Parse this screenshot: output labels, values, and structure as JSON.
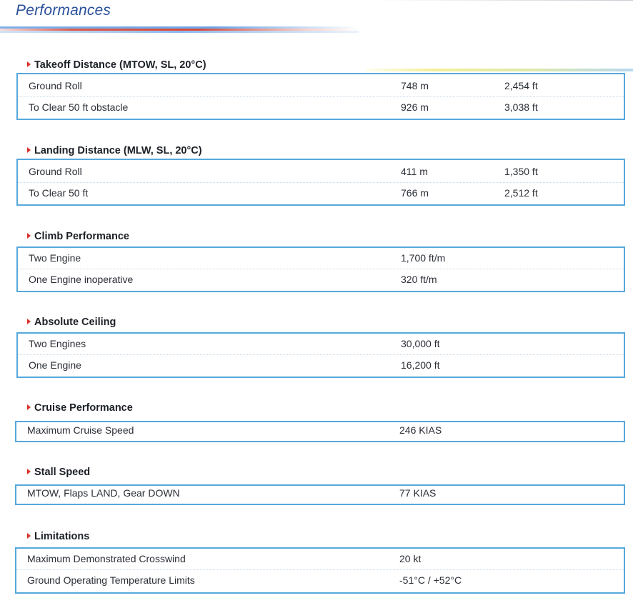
{
  "title": "Performances",
  "sections": [
    {
      "heading": "Takeoff Distance (MTOW, SL, 20°C)",
      "rows": [
        {
          "label": "Ground Roll",
          "value1": "748 m",
          "value2": "2,454 ft"
        },
        {
          "label": "To Clear 50 ft obstacle",
          "value1": "926 m",
          "value2": "3,038 ft"
        }
      ]
    },
    {
      "heading": "Landing Distance (MLW, SL, 20°C)",
      "rows": [
        {
          "label": "Ground Roll",
          "value1": "411 m",
          "value2": "1,350 ft"
        },
        {
          "label": "To Clear 50 ft",
          "value1": "766 m",
          "value2": "2,512 ft"
        }
      ]
    },
    {
      "heading": "Climb Performance",
      "rows": [
        {
          "label": "Two Engine",
          "value1": "1,700 ft/m"
        },
        {
          "label": "One Engine inoperative",
          "value1": "320 ft/m"
        }
      ]
    },
    {
      "heading": "Absolute Ceiling",
      "rows": [
        {
          "label": "Two Engines",
          "value1": "30,000 ft"
        },
        {
          "label": "One Engine",
          "value1": "16,200 ft"
        }
      ]
    },
    {
      "heading": "Cruise Performance",
      "rows": [
        {
          "label": "Maximum Cruise Speed",
          "value1": "246 KIAS"
        }
      ]
    },
    {
      "heading": "Stall Speed",
      "rows": [
        {
          "label": "MTOW, Flaps LAND, Gear DOWN",
          "value1": "77 KIAS"
        }
      ]
    },
    {
      "heading": "Limitations",
      "rows": [
        {
          "label": "Maximum Demonstrated Crosswind",
          "value1": "20 kt"
        },
        {
          "label": "Ground Operating Temperature Limits",
          "value1": "-51°C / +52°C"
        }
      ]
    }
  ],
  "colors": {
    "title": "#2a4f9a",
    "box_border": "#56a8dc",
    "marker": "#d8322a",
    "text": "#2a2e36"
  }
}
